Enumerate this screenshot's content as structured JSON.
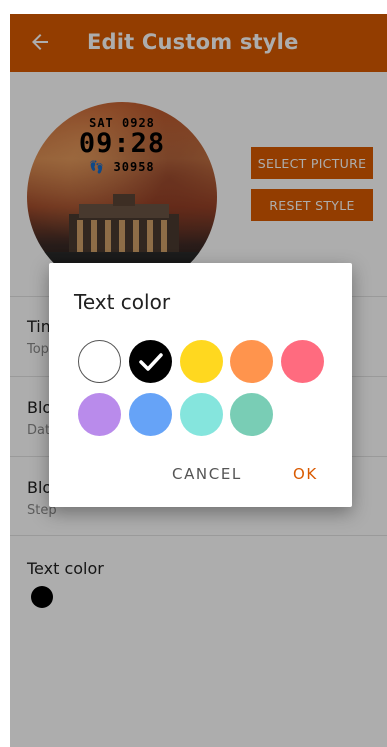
{
  "appbar": {
    "title": "Edit Custom style",
    "back_icon": "arrow-back-icon"
  },
  "preview": {
    "date": "SAT 0928",
    "time": "09:28",
    "steps": "30958",
    "steps_icon": "footsteps-icon"
  },
  "buttons": {
    "select_picture": "SELECT PICTURE",
    "reset_style": "RESET STYLE"
  },
  "settings": [
    {
      "title": "Time",
      "subtitle": "Top"
    },
    {
      "title": "Block",
      "subtitle": "Date"
    },
    {
      "title": "Block",
      "subtitle": "Step"
    }
  ],
  "text_color": {
    "label": "Text color",
    "current": "#000000"
  },
  "dialog": {
    "title": "Text color",
    "colors": [
      {
        "name": "white",
        "hex": "#FFFFFF",
        "selected": false
      },
      {
        "name": "black",
        "hex": "#000000",
        "selected": true
      },
      {
        "name": "yellow",
        "hex": "#FFD81F",
        "selected": false
      },
      {
        "name": "orange",
        "hex": "#FF944D",
        "selected": false
      },
      {
        "name": "pink",
        "hex": "#FF6B7F",
        "selected": false
      },
      {
        "name": "purple",
        "hex": "#B98BEB",
        "selected": false
      },
      {
        "name": "blue",
        "hex": "#66A3F7",
        "selected": false
      },
      {
        "name": "turquoise",
        "hex": "#85E5DD",
        "selected": false
      },
      {
        "name": "teal",
        "hex": "#79CDB5",
        "selected": false
      }
    ],
    "cancel": "CANCEL",
    "ok": "OK"
  },
  "colors": {
    "accent": "#D95A00",
    "scrim": "rgba(0,0,0,0.32)"
  }
}
